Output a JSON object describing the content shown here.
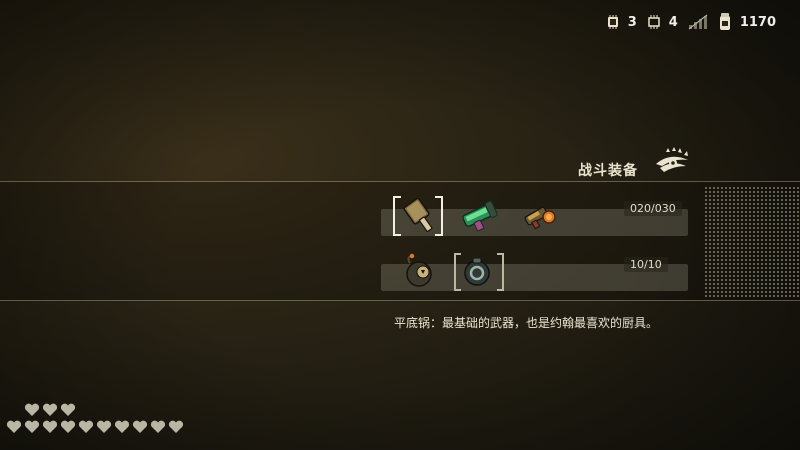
{
  "hud": {
    "chip_a_count": "3",
    "chip_b_count": "4",
    "money": "1170",
    "icons": [
      "chip-icon",
      "microchip-icon",
      "signal-icon",
      "salt-jar-icon"
    ]
  },
  "section": {
    "title": "战斗装备",
    "emblem": "feathered-eye-emblem"
  },
  "weapons": {
    "count": "020/030",
    "items": [
      "frying-pan",
      "green-blaster",
      "flamethrower"
    ],
    "selected": "frying-pan"
  },
  "tools": {
    "count": "10/10",
    "items": [
      "bomb",
      "ring-bomb"
    ]
  },
  "description": "平底锅：最基础的武器，也是约翰最喜欢的厨具。",
  "health": {
    "row1_hearts": 3,
    "row2_hearts": 10,
    "heart_color": "#b9b6a4"
  },
  "colors": {
    "text": "#e9e3cf",
    "slot_bg": "#827d6e",
    "accent_orange": "#e07a2a",
    "accent_green": "#5fd37a"
  }
}
